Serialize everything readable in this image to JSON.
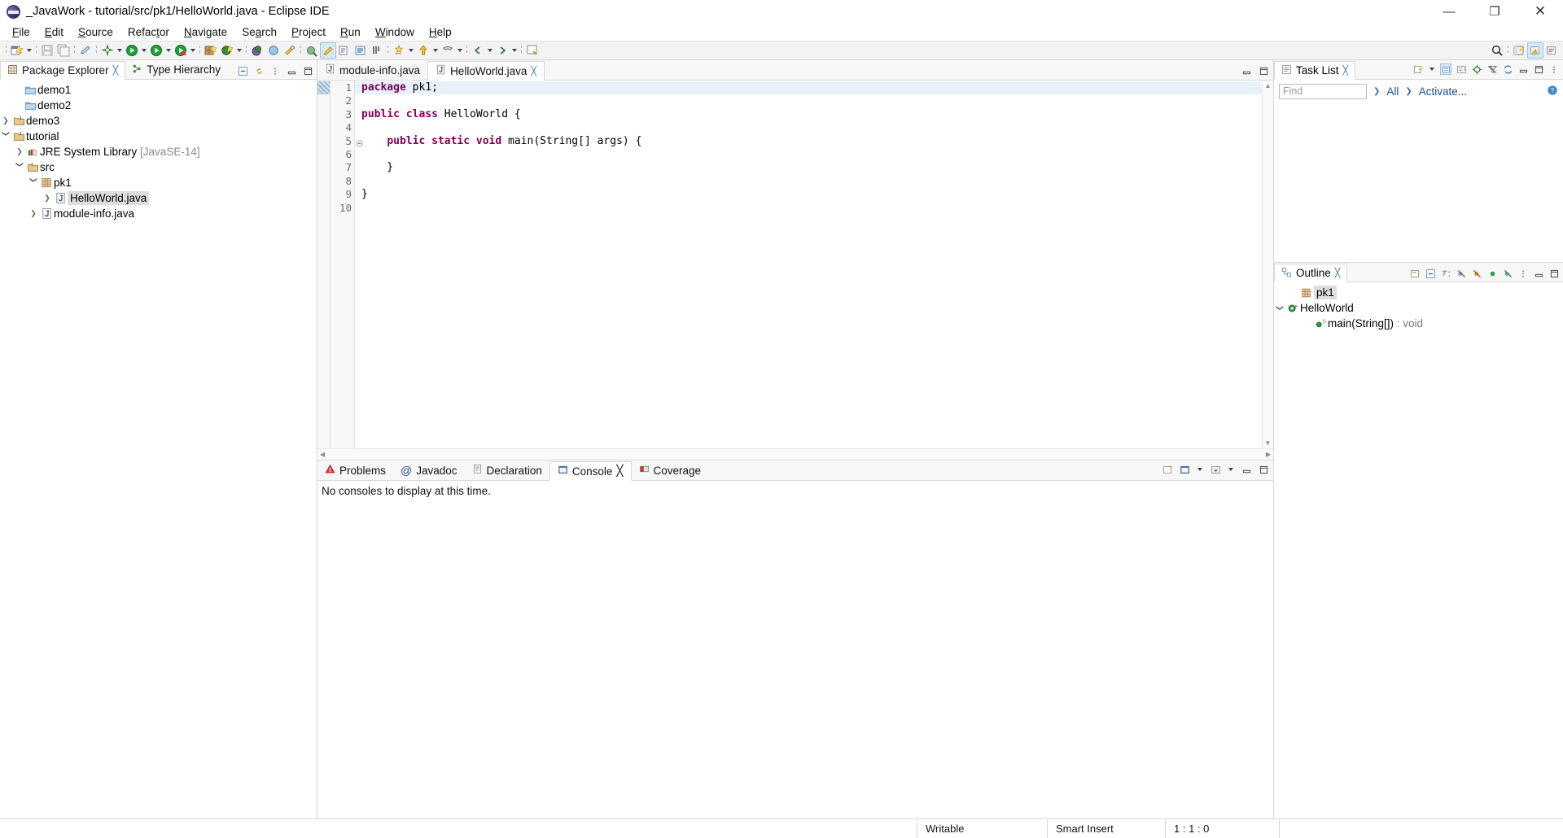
{
  "window": {
    "title": "_JavaWork - tutorial/src/pk1/HelloWorld.java - Eclipse IDE",
    "app_icon": "eclipse-icon",
    "minimize": "—",
    "maximize": "❐",
    "close": "✕"
  },
  "menubar": [
    {
      "label": "File",
      "mnemonic": "F"
    },
    {
      "label": "Edit",
      "mnemonic": "E"
    },
    {
      "label": "Source",
      "mnemonic": "S"
    },
    {
      "label": "Refactor",
      "mnemonic": "t"
    },
    {
      "label": "Navigate",
      "mnemonic": "N"
    },
    {
      "label": "Search",
      "mnemonic": "a"
    },
    {
      "label": "Project",
      "mnemonic": "P"
    },
    {
      "label": "Run",
      "mnemonic": "R"
    },
    {
      "label": "Window",
      "mnemonic": "W"
    },
    {
      "label": "Help",
      "mnemonic": "H"
    }
  ],
  "toolbar": {
    "icons": [
      "new-wizard-icon",
      "save-icon",
      "save-all-icon",
      "print-icon",
      "build-all-icon",
      "debug-icon",
      "run-icon",
      "run-coverage-icon",
      "new-java-project-icon",
      "new-package-icon",
      "new-class-icon",
      "external-tools-icon",
      "open-type-icon",
      "search-icon",
      "toggle-mark-occurrences-icon",
      "skip-all-breakpoints-icon",
      "next-annotation-icon",
      "previous-annotation-icon",
      "last-edit-location-icon",
      "back-icon",
      "forward-icon",
      "pin-editor-icon"
    ],
    "right_icons": [
      "search-icon",
      "open-perspective-icon",
      "java-perspective-icon",
      "java-ee-perspective-icon"
    ]
  },
  "package_explorer": {
    "tabs": [
      {
        "label": "Package Explorer",
        "icon": "package-explorer-icon",
        "active": true,
        "closable": true
      },
      {
        "label": "Type Hierarchy",
        "icon": "type-hierarchy-icon",
        "active": false,
        "closable": false
      }
    ],
    "actions": [
      "collapse-all-icon",
      "link-with-editor-icon",
      "view-menu-icon",
      "minimize-icon",
      "maximize-icon"
    ],
    "tree": [
      {
        "label": "demo1",
        "icon": "folder-icon",
        "indent": 1,
        "arrow": "",
        "selected": false
      },
      {
        "label": "demo2",
        "icon": "folder-icon",
        "indent": 1,
        "arrow": "",
        "selected": false
      },
      {
        "label": "demo3",
        "icon": "java-project-icon",
        "indent": 1,
        "arrow": "collapsed",
        "selected": false
      },
      {
        "label": "tutorial",
        "icon": "java-project-icon",
        "indent": 1,
        "arrow": "expanded",
        "selected": false
      },
      {
        "label": "JRE System Library",
        "suffix": "[JavaSE-14]",
        "icon": "library-icon",
        "indent": 2,
        "arrow": "collapsed",
        "selected": false
      },
      {
        "label": "src",
        "icon": "source-folder-icon",
        "indent": 2,
        "arrow": "expanded",
        "selected": false
      },
      {
        "label": "pk1",
        "icon": "package-icon",
        "indent": 3,
        "arrow": "expanded",
        "selected": false
      },
      {
        "label": "HelloWorld.java",
        "icon": "java-file-icon",
        "indent": 4,
        "arrow": "collapsed",
        "selected": true
      },
      {
        "label": "module-info.java",
        "icon": "java-file-icon",
        "indent": 3,
        "arrow": "collapsed",
        "selected": false
      }
    ]
  },
  "editor": {
    "tabs": [
      {
        "label": "module-info.java",
        "icon": "java-file-icon",
        "active": false,
        "closable": false
      },
      {
        "label": "HelloWorld.java",
        "icon": "java-file-icon",
        "active": true,
        "closable": true
      }
    ],
    "actions": [
      "minimize-icon",
      "maximize-icon"
    ],
    "lines": [
      {
        "num": "1",
        "text": "package pk1;",
        "current": true,
        "fold": false
      },
      {
        "num": "2",
        "text": "",
        "current": false,
        "fold": false
      },
      {
        "num": "3",
        "text": "public class HelloWorld {",
        "current": false,
        "fold": false
      },
      {
        "num": "4",
        "text": "",
        "current": false,
        "fold": false
      },
      {
        "num": "5",
        "text": "    public static void main(String[] args) {",
        "current": false,
        "fold": true
      },
      {
        "num": "6",
        "text": "",
        "current": false,
        "fold": false
      },
      {
        "num": "7",
        "text": "    }",
        "current": false,
        "fold": false
      },
      {
        "num": "8",
        "text": "",
        "current": false,
        "fold": false
      },
      {
        "num": "9",
        "text": "}",
        "current": false,
        "fold": false
      },
      {
        "num": "10",
        "text": "",
        "current": false,
        "fold": false
      }
    ],
    "keywords": [
      "package",
      "public",
      "class",
      "static",
      "void"
    ]
  },
  "bottom_panel": {
    "tabs": [
      {
        "label": "Problems",
        "icon": "problems-icon",
        "active": false,
        "closable": false
      },
      {
        "label": "Javadoc",
        "icon": "javadoc-icon",
        "active": false,
        "closable": false
      },
      {
        "label": "Declaration",
        "icon": "declaration-icon",
        "active": false,
        "closable": false
      },
      {
        "label": "Console",
        "icon": "console-icon",
        "active": true,
        "closable": true
      },
      {
        "label": "Coverage",
        "icon": "coverage-icon",
        "active": false,
        "closable": false
      }
    ],
    "actions": [
      "open-console-icon",
      "display-selected-console-icon",
      "view-menu-icon",
      "minimize-icon",
      "maximize-icon"
    ],
    "console_message": "No consoles to display at this time."
  },
  "task_list": {
    "tab_label": "Task List",
    "tab_icon": "task-list-icon",
    "actions": [
      "new-task-icon",
      "dropdown-icon",
      "categorized-icon",
      "schedule-icon",
      "focus-icon",
      "filter-icon",
      "synchronize-icon",
      "minimize-icon",
      "maximize-icon",
      "view-menu-icon"
    ],
    "find_placeholder": "Find",
    "find_value": "",
    "all_label": "All",
    "activate_label": "Activate...",
    "help_icon": "help-icon"
  },
  "outline": {
    "tab_label": "Outline",
    "tab_icon": "outline-icon",
    "actions": [
      "focus-on-active-task-icon",
      "collapse-all-icon",
      "sort-icon",
      "hide-fields-icon",
      "hide-static-icon",
      "hide-nonpublic-icon",
      "hide-local-types-icon",
      "view-menu-icon",
      "minimize-icon",
      "maximize-icon"
    ],
    "tree": [
      {
        "label": "pk1",
        "icon": "package-icon",
        "indent": 1,
        "arrow": "",
        "selected": true,
        "ret": ""
      },
      {
        "label": "HelloWorld",
        "icon": "class-icon",
        "indent": 1,
        "arrow": "expanded",
        "selected": false,
        "ret": ""
      },
      {
        "label": "main(String[])",
        "icon": "method-static-icon",
        "indent": 2,
        "arrow": "",
        "selected": false,
        "ret": " : void"
      }
    ]
  },
  "statusbar": {
    "writable": "Writable",
    "insert_mode": "Smart Insert",
    "position": "1 : 1 : 0"
  }
}
